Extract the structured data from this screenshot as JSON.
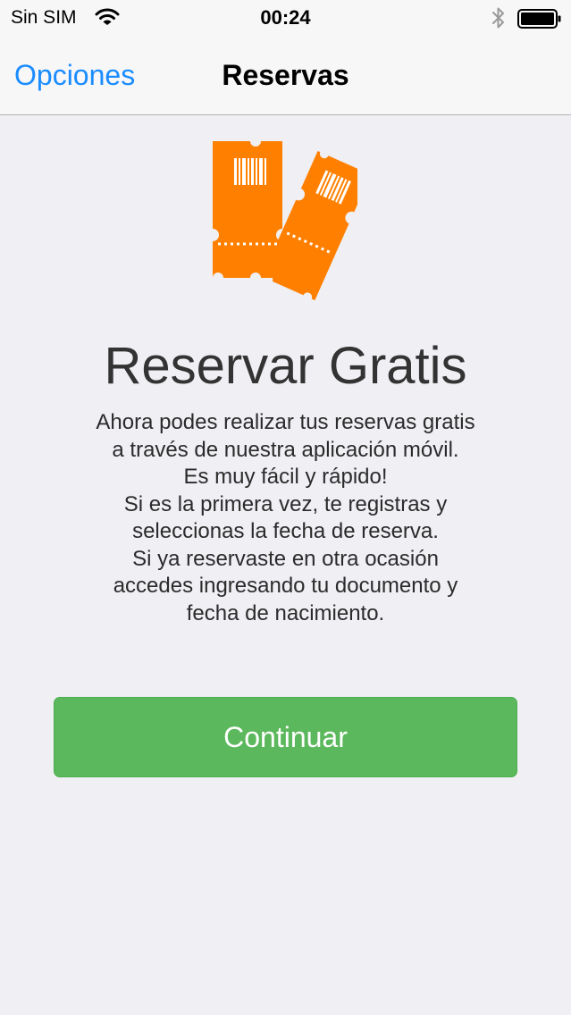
{
  "status_bar": {
    "carrier": "Sin SIM",
    "time": "00:24",
    "icons": [
      "wifi-icon",
      "bluetooth-icon",
      "battery-icon"
    ]
  },
  "nav_bar": {
    "back_label": "Opciones",
    "title": "Reservas"
  },
  "hero": {
    "icon": "tickets-icon",
    "icon_color": "#ff8000",
    "title": "Reservar Gratis",
    "description_lines": [
      "Ahora podes realizar tus reservas gratis",
      "a través de nuestra aplicación móvil.",
      "Es muy fácil y rápido!",
      "Si es la primera vez, te registras y",
      "seleccionas la fecha de reserva.",
      "Si ya reservaste en otra ocasión",
      "accedes ingresando tu documento y",
      "fecha de nacimiento."
    ]
  },
  "actions": {
    "continue_label": "Continuar",
    "continue_color": "#5cb85c"
  },
  "colors": {
    "background": "#efeff4",
    "accent": "#1a8cff"
  }
}
